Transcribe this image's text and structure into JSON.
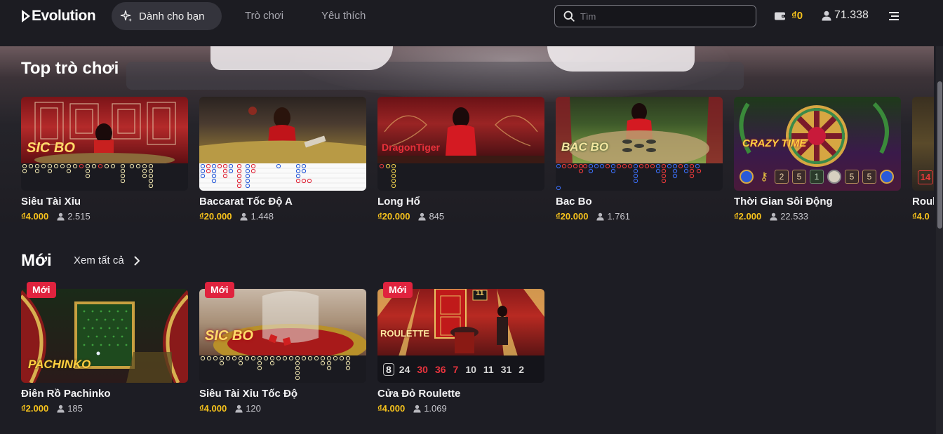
{
  "header": {
    "logo_text": "Evolution",
    "nav": {
      "active_label": "Dành cho bạn",
      "games_label": "Trò chơi",
      "favorites_label": "Yêu thích"
    },
    "search_placeholder": "Tìm",
    "balance": "₫0",
    "online_players": "71.338"
  },
  "sections": {
    "top": {
      "title": "Top trò chơi",
      "cards": [
        {
          "name": "Siêu Tài Xỉu",
          "bet": "₫4.000",
          "players": "2.515",
          "scene_text": "SIC BO"
        },
        {
          "name": "Baccarat Tốc Độ A",
          "bet": "₫20.000",
          "players": "1.448",
          "scene_text": ""
        },
        {
          "name": "Long Hổ",
          "bet": "₫20.000",
          "players": "845",
          "scene_text": "DragonTiger"
        },
        {
          "name": "Bac Bo",
          "bet": "₫20.000",
          "players": "1.761",
          "scene_text": "BAC BO"
        },
        {
          "name": "Thời Gian Sôi Động",
          "bet": "₫2.000",
          "players": "22.533",
          "scene_text": "CRAZY TIME",
          "results": [
            "2",
            "5",
            "1",
            "5",
            "5"
          ]
        },
        {
          "name": "Roul",
          "bet": "₫4.0",
          "players": "",
          "scene_text": "",
          "results": [
            "14"
          ]
        }
      ]
    },
    "new": {
      "title": "Mới",
      "see_all": "Xem tất cả",
      "badge": "Mới",
      "cards": [
        {
          "name": "Điên Rồ Pachinko",
          "bet": "₫2.000",
          "players": "185",
          "scene_text": "PACHINKO"
        },
        {
          "name": "Siêu Tài Xỉu Tốc Độ",
          "bet": "₫4.000",
          "players": "120",
          "scene_text": "SIC BO"
        },
        {
          "name": "Cửa Đỏ Roulette",
          "bet": "₫4.000",
          "players": "1.069",
          "scene_text": "ROULETTE",
          "results": [
            "8",
            "24",
            "30",
            "36",
            "7",
            "10",
            "11",
            "31",
            "2"
          ]
        }
      ]
    }
  },
  "colors": {
    "accent_gold": "#f6c21c",
    "badge_red": "#e0233e",
    "background": "#1d1d24",
    "result_red": "#e8343e"
  },
  "icons": {
    "nav_active": "sparkle-icon",
    "search": "search-icon",
    "wallet": "wallet-icon",
    "players": "user-icon",
    "menu": "menu-icon",
    "see_all": "chevron-right-icon"
  }
}
